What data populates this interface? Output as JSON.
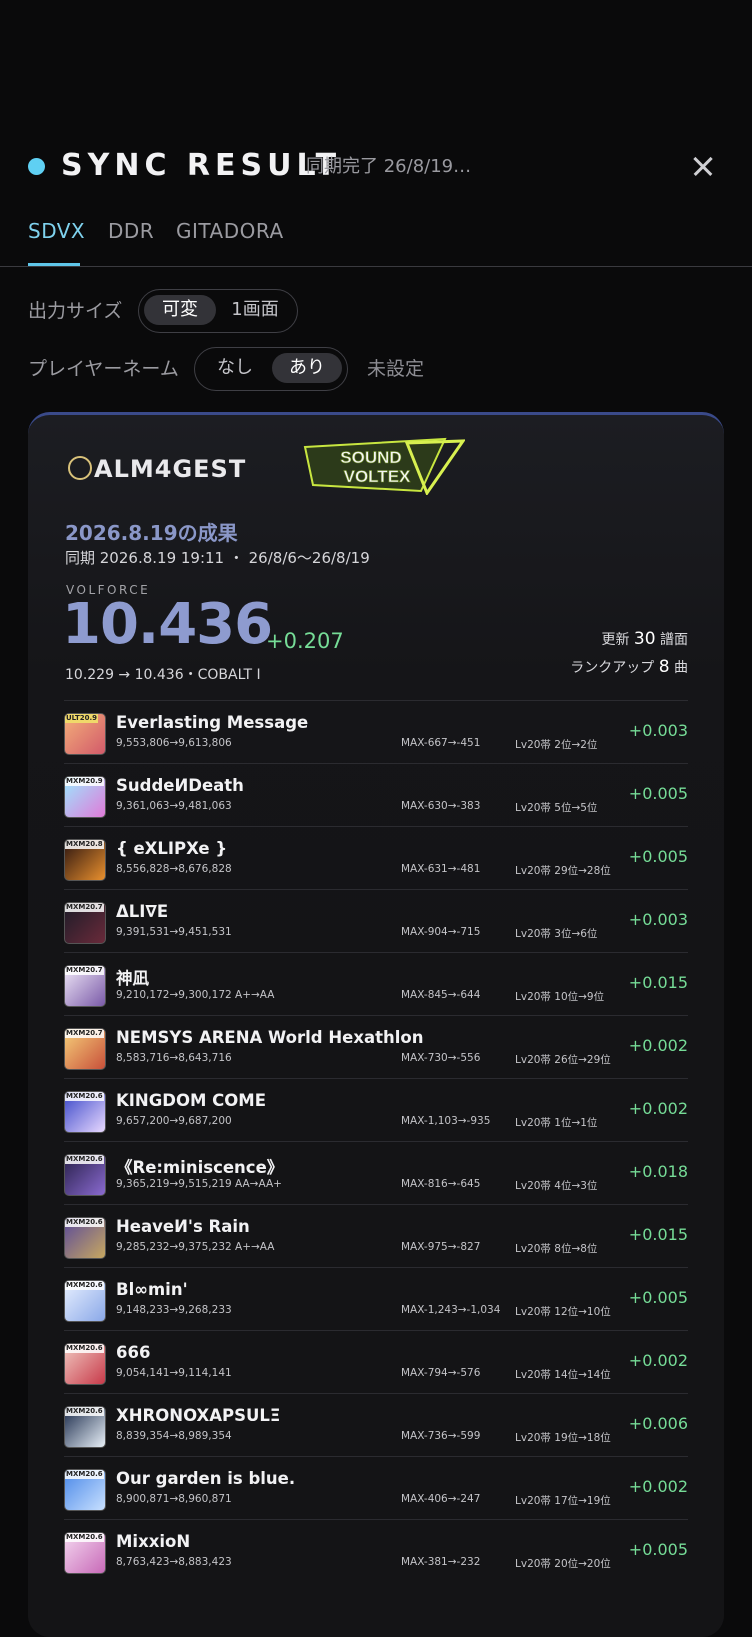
{
  "header": {
    "title": "SYNC RESULT",
    "status": "同期完了 26/8/19…",
    "accent_color": "#5fd0f3"
  },
  "tabs": [
    {
      "label": "SDVX",
      "active": true
    },
    {
      "label": "DDR",
      "active": false
    },
    {
      "label": "GITADORA",
      "active": false
    }
  ],
  "options": {
    "output_size": {
      "label": "出力サイズ",
      "choices": [
        "可変",
        "1画面"
      ],
      "selected": "可変"
    },
    "player_name": {
      "label": "プレイヤーネーム",
      "choices": [
        "なし",
        "あり"
      ],
      "selected": "あり",
      "value": "未設定"
    }
  },
  "card": {
    "brand_logo": "ALM4GEST",
    "game_logo_lines": [
      "SOUND",
      "VOLTEX"
    ],
    "date_title": "2026.8.19の成果",
    "sync_line": "同期 2026.8.19 19:11 ・ 26/8/6〜26/8/19",
    "volforce_label": "VOLFORCE",
    "volforce_value": "10.436",
    "volforce_delta": "+0.207",
    "volforce_sub": "10.229 → 10.436・COBALT Ⅰ",
    "updates_prefix": "更新",
    "updates_count": "30",
    "updates_suffix": "譜面",
    "rankup_prefix": "ランクアップ",
    "rankup_count": "8",
    "rankup_suffix": "曲"
  },
  "songs": [
    {
      "level": "ULT20.9",
      "title": "Everlasting Message",
      "score": "9,553,806→9,613,806",
      "max": "MAX-667→-451",
      "rank": "Lv20帯 2位→2位",
      "delta": "+0.003",
      "art": [
        "#f4b07a",
        "#d25a6a"
      ]
    },
    {
      "level": "MXM20.9",
      "title": "SuddeИDeath",
      "score": "9,361,063→9,481,063",
      "max": "MAX-630→-383",
      "rank": "Lv20帯 5位→5位",
      "delta": "+0.005",
      "art": [
        "#9be8ff",
        "#e07ad8"
      ]
    },
    {
      "level": "MXM20.8",
      "title": "{ eXLIPXe }",
      "score": "8,556,828→8,676,828",
      "max": "MAX-631→-481",
      "rank": "Lv20帯 29位→28位",
      "delta": "+0.005",
      "art": [
        "#2a1410",
        "#e9902e"
      ]
    },
    {
      "level": "MXM20.7",
      "title": "ΔLI∇E",
      "score": "9,391,531→9,451,531",
      "max": "MAX-904→-715",
      "rank": "Lv20帯 3位→6位",
      "delta": "+0.003",
      "art": [
        "#1c1c28",
        "#6a2a3a"
      ]
    },
    {
      "level": "MXM20.7",
      "title": "神凪",
      "score": "9,210,172→9,300,172 A+→AA",
      "max": "MAX-845→-644",
      "rank": "Lv20帯 10位→9位",
      "delta": "+0.015",
      "art": [
        "#f0e8f8",
        "#7a5aa8"
      ]
    },
    {
      "level": "MXM20.7",
      "title": "NEMSYS ARENA World Hexathlon",
      "score": "8,583,716→8,643,716",
      "max": "MAX-730→-556",
      "rank": "Lv20帯 26位→29位",
      "delta": "+0.002",
      "art": [
        "#f6d07a",
        "#c8503a"
      ]
    },
    {
      "level": "MXM20.6",
      "title": "KINGDOM COME",
      "score": "9,657,200→9,687,200",
      "max": "MAX-1,103→-935",
      "rank": "Lv20帯 1位→1位",
      "delta": "+0.002",
      "art": [
        "#3a48c8",
        "#e8d8ff"
      ]
    },
    {
      "level": "MXM20.6",
      "title": "《Re:miniscence》",
      "score": "9,365,219→9,515,219 AA→AA+",
      "max": "MAX-816→-645",
      "rank": "Lv20帯 4位→3位",
      "delta": "+0.018",
      "art": [
        "#28204a",
        "#8a6ad0"
      ]
    },
    {
      "level": "MXM20.6",
      "title": "HeaveИ's Rain",
      "score": "9,285,232→9,375,232 A+→AA",
      "max": "MAX-975→-827",
      "rank": "Lv20帯 8位→8位",
      "delta": "+0.015",
      "art": [
        "#5a4a9a",
        "#c8a860"
      ]
    },
    {
      "level": "MXM20.6",
      "title": "Bl∞min'",
      "score": "9,148,233→9,268,233",
      "max": "MAX-1,243→-1,034",
      "rank": "Lv20帯 12位→10位",
      "delta": "+0.005",
      "art": [
        "#e8f0ff",
        "#8aa8e8"
      ]
    },
    {
      "level": "MXM20.6",
      "title": "666",
      "score": "9,054,141→9,114,141",
      "max": "MAX-794→-576",
      "rank": "Lv20帯 14位→14位",
      "delta": "+0.002",
      "art": [
        "#f0c8c0",
        "#c83a4a"
      ]
    },
    {
      "level": "MXM20.6",
      "title": "XHRONOXAPSULΞ",
      "score": "8,839,354→8,989,354",
      "max": "MAX-736→-599",
      "rank": "Lv20帯 19位→18位",
      "delta": "+0.006",
      "art": [
        "#1a2a4a",
        "#e8f0f8"
      ]
    },
    {
      "level": "MXM20.6",
      "title": "Our garden is blue.",
      "score": "8,900,871→8,960,871",
      "max": "MAX-406→-247",
      "rank": "Lv20帯 17位→19位",
      "delta": "+0.002",
      "art": [
        "#4a88e8",
        "#c8e0ff"
      ]
    },
    {
      "level": "MXM20.6",
      "title": "MixxioN",
      "score": "8,763,423→8,883,423",
      "max": "MAX-381→-232",
      "rank": "Lv20帯 20位→20位",
      "delta": "+0.005",
      "art": [
        "#f4d8f0",
        "#c86ab8"
      ]
    }
  ]
}
